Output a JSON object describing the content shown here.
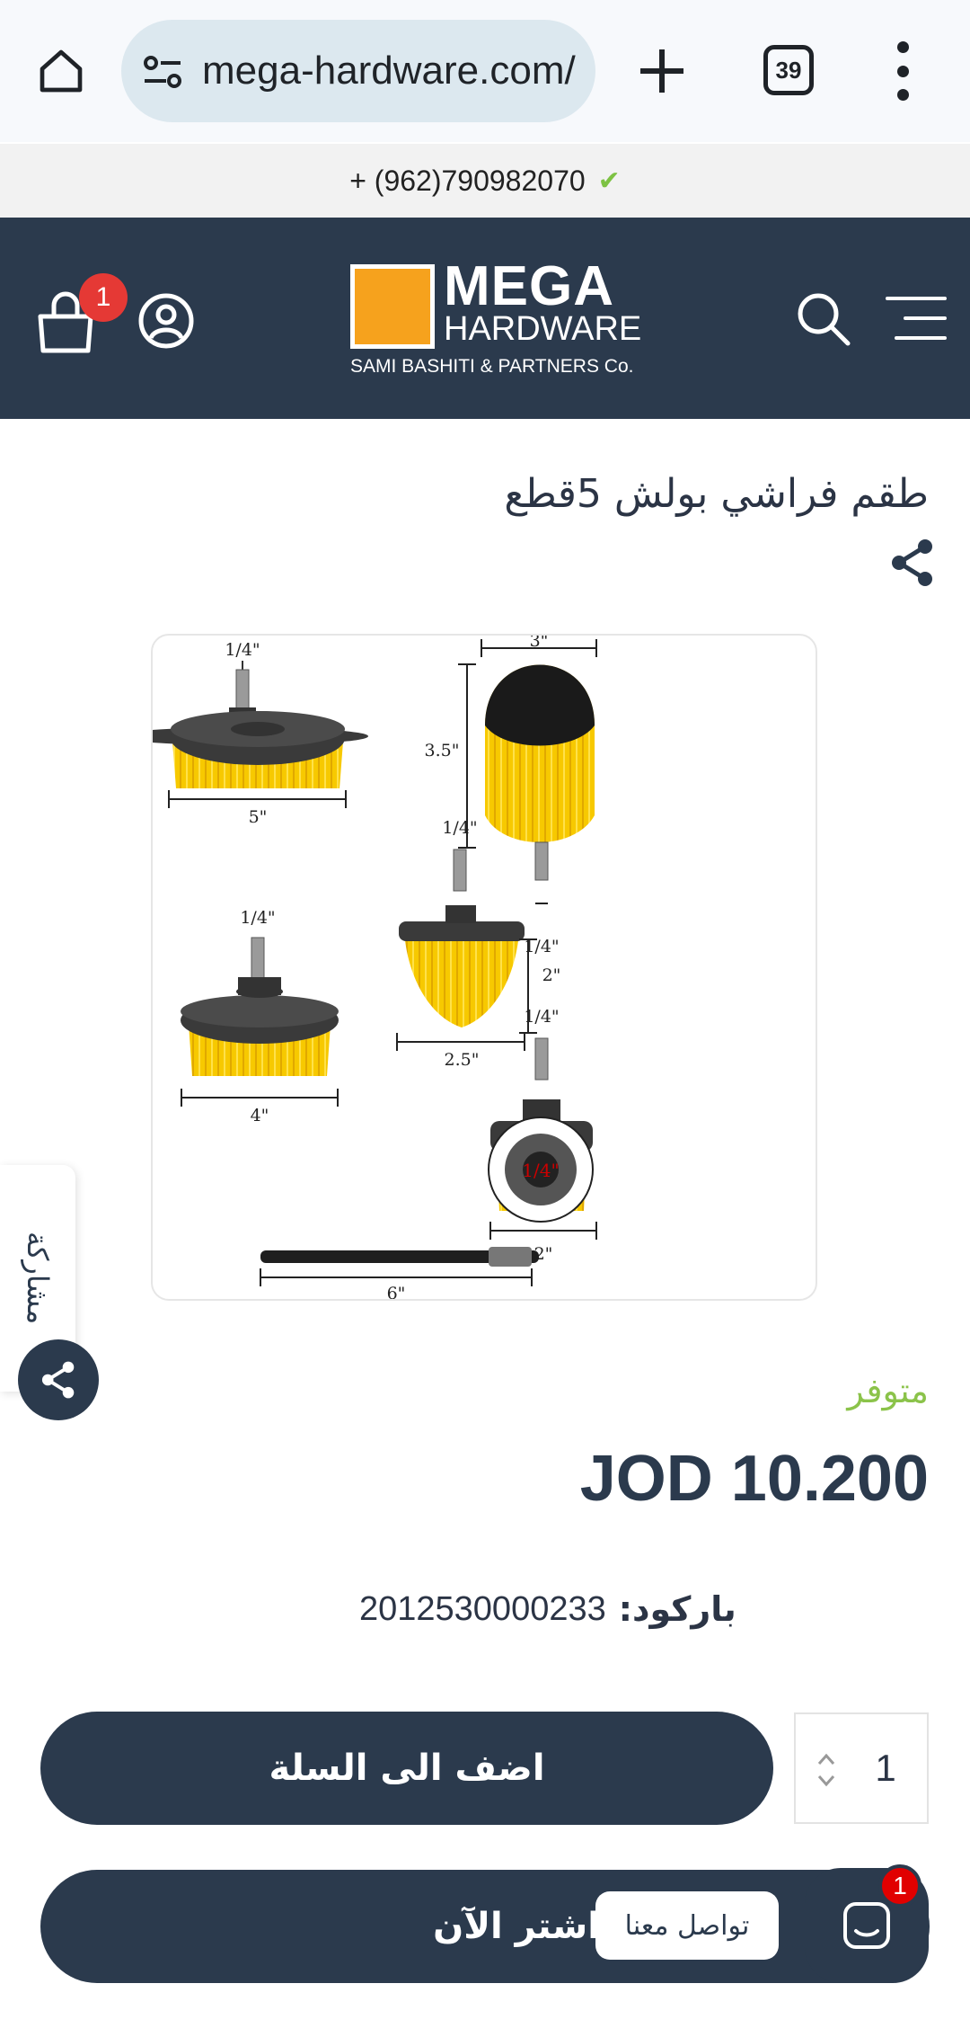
{
  "browser": {
    "url": "mega-hardware.com/",
    "tab_count": "39"
  },
  "topbar": {
    "phone": "+ (962)790982070",
    "check_icon": "✔"
  },
  "header": {
    "cart_count": "1",
    "logo": {
      "mega": "MEGA",
      "hardware": "HARDWARE",
      "sub": "SAMI BASHITI & PARTNERS Co."
    },
    "colors": {
      "background": "#2b3a4d",
      "logo_mark": "#f6a21d"
    }
  },
  "product": {
    "title": "طقم فراشي بولش 5قطع",
    "stock": "متوفر",
    "price": "JOD 10.200",
    "barcode_label": "باركود:",
    "barcode_value": "2012530000233",
    "quantity": "1",
    "image_labels": {
      "a_shank": "1/4\"",
      "a_width": "5\"",
      "b_shank": "1/4\"",
      "b_width": "4\"",
      "c_width": "3\"",
      "c_height": "3.5\"",
      "c_shank": "1/4\"",
      "d_shank": "1/4\"",
      "d_height": "2\"",
      "d_width": "2.5\"",
      "e_shank": "1/4\"",
      "e_width": "2\"",
      "ext_length": "6\"",
      "socket": "1/4\""
    }
  },
  "side": {
    "tab_label": "مشاركة"
  },
  "actions": {
    "add_to_cart": "اضف الى السلة",
    "buy_now": "اشتر الآن",
    "contact_us": "تواصل معنا",
    "chat_badge": "1"
  }
}
